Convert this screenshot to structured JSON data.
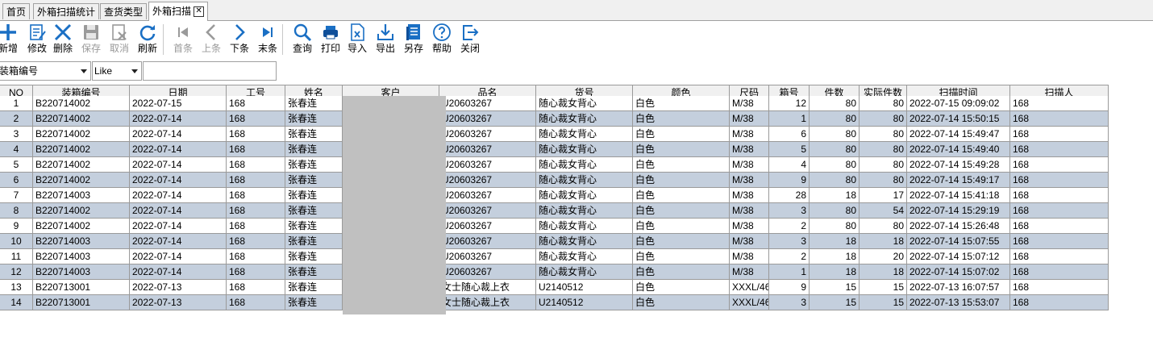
{
  "tabs": [
    {
      "label": "首页",
      "active": false
    },
    {
      "label": "外箱扫描统计",
      "active": false
    },
    {
      "label": "查货类型",
      "active": false
    },
    {
      "label": "外箱扫描",
      "active": true
    }
  ],
  "tab_close_glyph": "✕",
  "toolbar": [
    {
      "label": "新增",
      "icon": "plus-icon",
      "disabled": false
    },
    {
      "label": "修改",
      "icon": "edit-document-icon",
      "disabled": false
    },
    {
      "label": "删除",
      "icon": "delete-x-icon",
      "disabled": false
    },
    {
      "label": "保存",
      "icon": "save-disk-icon",
      "disabled": true
    },
    {
      "label": "取消",
      "icon": "cancel-document-icon",
      "disabled": true
    },
    {
      "label": "刷新",
      "icon": "refresh-icon",
      "disabled": false
    },
    {
      "label": "首条",
      "icon": "first-record-icon",
      "disabled": true
    },
    {
      "label": "上条",
      "icon": "previous-record-icon",
      "disabled": true
    },
    {
      "label": "下条",
      "icon": "next-record-icon",
      "disabled": false
    },
    {
      "label": "末条",
      "icon": "last-record-icon",
      "disabled": false
    },
    {
      "label": "查询",
      "icon": "search-icon",
      "disabled": false
    },
    {
      "label": "打印",
      "icon": "printer-icon",
      "disabled": false
    },
    {
      "label": "导入",
      "icon": "import-excel-icon",
      "disabled": false
    },
    {
      "label": "导出",
      "icon": "export-icon",
      "disabled": false
    },
    {
      "label": "另存",
      "icon": "save-as-icon",
      "disabled": false
    },
    {
      "label": "帮助",
      "icon": "help-icon",
      "disabled": false
    },
    {
      "label": "关闭",
      "icon": "close-exit-icon",
      "disabled": false
    }
  ],
  "filter": {
    "field": "装箱编号",
    "operator": "Like",
    "value": ""
  },
  "colors": {
    "accent_blue": "#1a6fc4",
    "alt_row": "#c4cfdd",
    "masked_cell": "#c0c0c0"
  },
  "table": {
    "columns": [
      "NO",
      "装箱编号",
      "日期",
      "工号",
      "姓名",
      "客户",
      "品名",
      "货号",
      "颜色",
      "尺码",
      "箱号",
      "件数",
      "实际件数",
      "扫描时间",
      "扫描人"
    ],
    "rows": [
      [
        "1",
        "B220714002",
        "2022-07-15",
        "168",
        "张春连",
        "",
        "U20603267",
        "随心裁女背心",
        "白色",
        "M/38",
        "12",
        "80",
        "80",
        "2022-07-15 09:09:02",
        "168"
      ],
      [
        "2",
        "B220714002",
        "2022-07-14",
        "168",
        "张春连",
        "",
        "U20603267",
        "随心裁女背心",
        "白色",
        "M/38",
        "1",
        "80",
        "80",
        "2022-07-14 15:50:15",
        "168"
      ],
      [
        "3",
        "B220714002",
        "2022-07-14",
        "168",
        "张春连",
        "",
        "U20603267",
        "随心裁女背心",
        "白色",
        "M/38",
        "6",
        "80",
        "80",
        "2022-07-14 15:49:47",
        "168"
      ],
      [
        "4",
        "B220714002",
        "2022-07-14",
        "168",
        "张春连",
        "",
        "U20603267",
        "随心裁女背心",
        "白色",
        "M/38",
        "5",
        "80",
        "80",
        "2022-07-14 15:49:40",
        "168"
      ],
      [
        "5",
        "B220714002",
        "2022-07-14",
        "168",
        "张春连",
        "",
        "U20603267",
        "随心裁女背心",
        "白色",
        "M/38",
        "4",
        "80",
        "80",
        "2022-07-14 15:49:28",
        "168"
      ],
      [
        "6",
        "B220714002",
        "2022-07-14",
        "168",
        "张春连",
        "",
        "U20603267",
        "随心裁女背心",
        "白色",
        "M/38",
        "9",
        "80",
        "80",
        "2022-07-14 15:49:17",
        "168"
      ],
      [
        "7",
        "B220714003",
        "2022-07-14",
        "168",
        "张春连",
        "",
        "U20603267",
        "随心裁女背心",
        "白色",
        "M/38",
        "28",
        "18",
        "17",
        "2022-07-14 15:41:18",
        "168"
      ],
      [
        "8",
        "B220714002",
        "2022-07-14",
        "168",
        "张春连",
        "",
        "U20603267",
        "随心裁女背心",
        "白色",
        "M/38",
        "3",
        "80",
        "54",
        "2022-07-14 15:29:19",
        "168"
      ],
      [
        "9",
        "B220714002",
        "2022-07-14",
        "168",
        "张春连",
        "",
        "U20603267",
        "随心裁女背心",
        "白色",
        "M/38",
        "2",
        "80",
        "80",
        "2022-07-14 15:26:48",
        "168"
      ],
      [
        "10",
        "B220714003",
        "2022-07-14",
        "168",
        "张春连",
        "",
        "U20603267",
        "随心裁女背心",
        "白色",
        "M/38",
        "3",
        "18",
        "18",
        "2022-07-14 15:07:55",
        "168"
      ],
      [
        "11",
        "B220714003",
        "2022-07-14",
        "168",
        "张春连",
        "",
        "U20603267",
        "随心裁女背心",
        "白色",
        "M/38",
        "2",
        "18",
        "20",
        "2022-07-14 15:07:12",
        "168"
      ],
      [
        "12",
        "B220714003",
        "2022-07-14",
        "168",
        "张春连",
        "",
        "U20603267",
        "随心裁女背心",
        "白色",
        "M/38",
        "1",
        "18",
        "18",
        "2022-07-14 15:07:02",
        "168"
      ],
      [
        "13",
        "B220713001",
        "2022-07-13",
        "168",
        "张春连",
        "",
        "女士随心裁上衣",
        "U2140512",
        "白色",
        "XXXL/46",
        "9",
        "15",
        "15",
        "2022-07-13 16:07:57",
        "168"
      ],
      [
        "14",
        "B220713001",
        "2022-07-13",
        "168",
        "张春连",
        "",
        "女士随心裁上衣",
        "U2140512",
        "白色",
        "XXXL/46",
        "3",
        "15",
        "15",
        "2022-07-13 15:53:07",
        "168"
      ]
    ]
  }
}
